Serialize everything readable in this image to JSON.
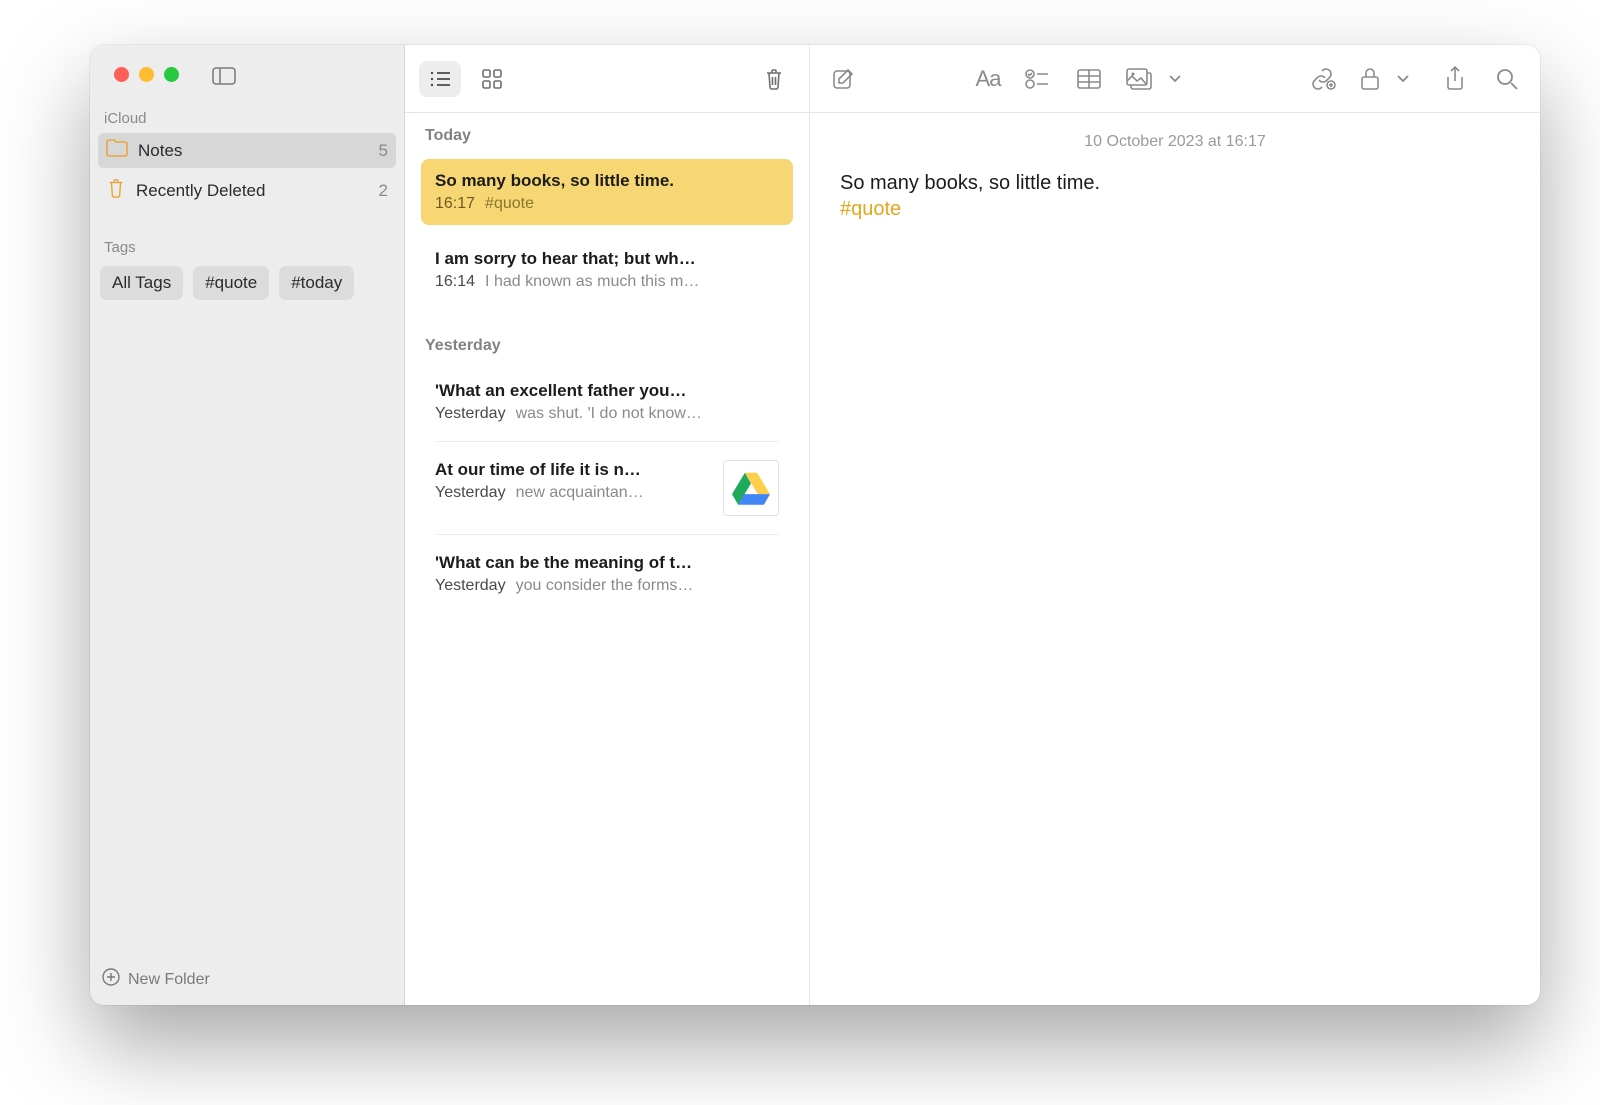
{
  "sidebar": {
    "account_label": "iCloud",
    "items": [
      {
        "icon": "folder",
        "label": "Notes",
        "count": "5",
        "selected": true
      },
      {
        "icon": "trash",
        "label": "Recently Deleted",
        "count": "2",
        "selected": false
      }
    ],
    "tags_label": "Tags",
    "tags": [
      "All Tags",
      "#quote",
      "#today"
    ],
    "new_folder_label": "New Folder"
  },
  "notes_list": {
    "groups": [
      {
        "label": "Today",
        "notes": [
          {
            "title": "So many books, so little time.",
            "time": "16:17",
            "snippet": "#quote",
            "selected": true
          },
          {
            "title": "I am sorry to hear that; but wh…",
            "time": "16:14",
            "snippet": "I had known as much this m…"
          }
        ]
      },
      {
        "label": "Yesterday",
        "notes": [
          {
            "title": "'What an excellent father you…",
            "time": "Yesterday",
            "snippet": "was shut. 'I do not know…"
          },
          {
            "title": "At our time of life it is n…",
            "time": "Yesterday",
            "snippet": "new acquaintan…",
            "thumb": "drive"
          },
          {
            "title": "'What can be the meaning of t…",
            "time": "Yesterday",
            "snippet": "you consider the forms…"
          }
        ]
      }
    ]
  },
  "editor": {
    "timestamp": "10 October 2023 at 16:17",
    "body_line": "So many books, so little time.",
    "hashtag": "#quote"
  },
  "toolbar": {
    "format_label": "Aa"
  }
}
